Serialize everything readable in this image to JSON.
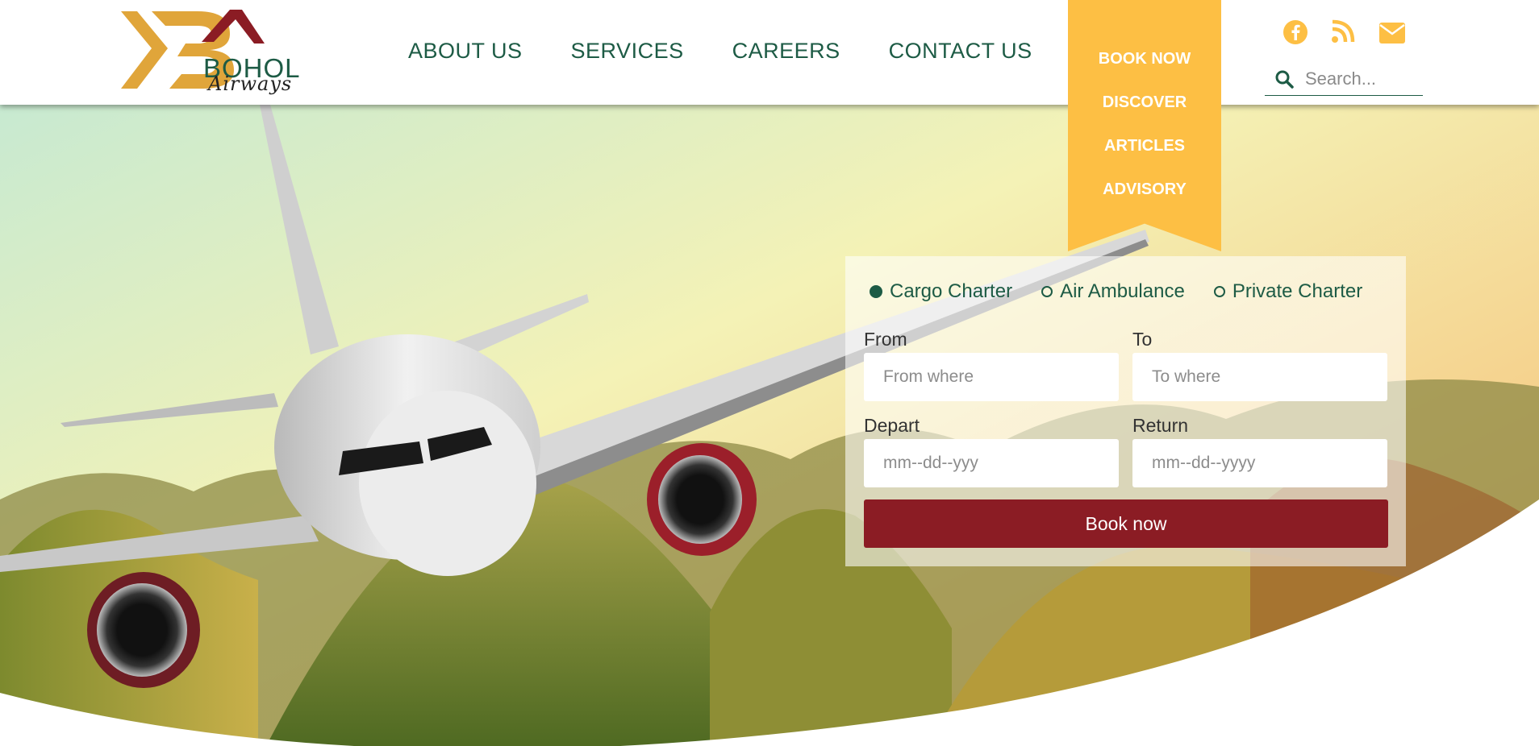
{
  "brand": {
    "name": "BOHOL",
    "tagline": "Airways",
    "colors": {
      "green": "#1d5b45",
      "gold": "#fdbf44",
      "maroon": "#8b1c24"
    }
  },
  "nav": {
    "items": [
      {
        "label": "ABOUT US"
      },
      {
        "label": "SERVICES"
      },
      {
        "label": "CAREERS"
      },
      {
        "label": "CONTACT US"
      }
    ]
  },
  "ribbon": {
    "items": [
      {
        "label": "BOOK NOW"
      },
      {
        "label": "DISCOVER"
      },
      {
        "label": "ARTICLES"
      },
      {
        "label": "ADVISORY"
      }
    ]
  },
  "social": {
    "icons": [
      "facebook-icon",
      "rss-icon",
      "envelope-icon"
    ]
  },
  "search": {
    "placeholder": "Search..."
  },
  "booking": {
    "options": [
      {
        "label": "Cargo Charter",
        "selected": true
      },
      {
        "label": "Air Ambulance",
        "selected": false
      },
      {
        "label": "Private Charter",
        "selected": false
      }
    ],
    "from": {
      "label": "From",
      "placeholder": "From where"
    },
    "to": {
      "label": "To",
      "placeholder": "To where"
    },
    "depart": {
      "label": "Depart",
      "placeholder": "mm--dd--yyy"
    },
    "return": {
      "label": "Return",
      "placeholder": "mm--dd--yyyy"
    },
    "submit_label": "Book now"
  }
}
